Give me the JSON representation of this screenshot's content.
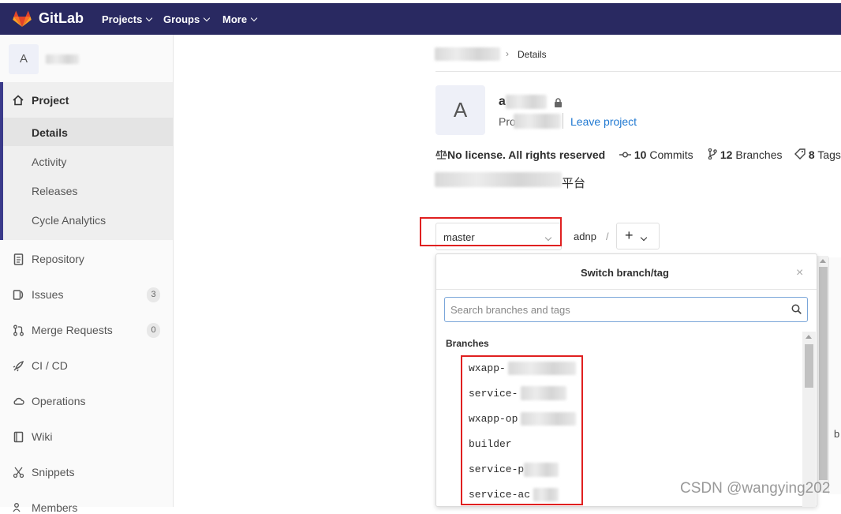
{
  "navbar": {
    "brand": "GitLab",
    "items": [
      {
        "label": "Projects"
      },
      {
        "label": "Groups"
      },
      {
        "label": "More"
      }
    ],
    "color": "#292961"
  },
  "sidebar": {
    "project_avatar": "A",
    "section_title": "Project",
    "sub_items": [
      {
        "label": "Details",
        "active": true
      },
      {
        "label": "Activity"
      },
      {
        "label": "Releases"
      },
      {
        "label": "Cycle Analytics"
      }
    ],
    "items": [
      {
        "label": "Repository",
        "icon": "file-icon"
      },
      {
        "label": "Issues",
        "icon": "issues-icon",
        "count": "3"
      },
      {
        "label": "Merge Requests",
        "icon": "merge-icon",
        "count": "0"
      },
      {
        "label": "CI / CD",
        "icon": "rocket-icon"
      },
      {
        "label": "Operations",
        "icon": "cloud-icon"
      },
      {
        "label": "Wiki",
        "icon": "book-icon"
      },
      {
        "label": "Snippets",
        "icon": "scissors-icon"
      },
      {
        "label": "Members",
        "icon": "users-icon"
      }
    ]
  },
  "breadcrumb": {
    "current": "Details"
  },
  "project": {
    "avatar": "A",
    "name_visible": "a",
    "id_visible": "Pro",
    "leave_label": "Leave project",
    "license": "No license. All rights reserved",
    "commits_count": "10",
    "commits_label": "Commits",
    "branches_count": "12",
    "branches_label": "Branches",
    "tags_count": "8",
    "tags_label": "Tags",
    "description_visible": "平台"
  },
  "repo_bar": {
    "branch": "master",
    "path": "adnp",
    "slash": "/",
    "add_label": "+"
  },
  "dropdown": {
    "title": "Switch branch/tag",
    "close": "×",
    "search_placeholder": "Search branches and tags",
    "section": "Branches",
    "branches": [
      {
        "label": "wxapp-"
      },
      {
        "label": "service-"
      },
      {
        "label": "wxapp-op"
      },
      {
        "label": "builder"
      },
      {
        "label": "service-p"
      },
      {
        "label": "service-ac"
      }
    ]
  },
  "edge_text": "b",
  "watermark": "CSDN @wangying202",
  "colors": {
    "accent": "#1f78d1",
    "highlight_box": "#e02020",
    "sidebar_active": "#3a3a8a"
  }
}
